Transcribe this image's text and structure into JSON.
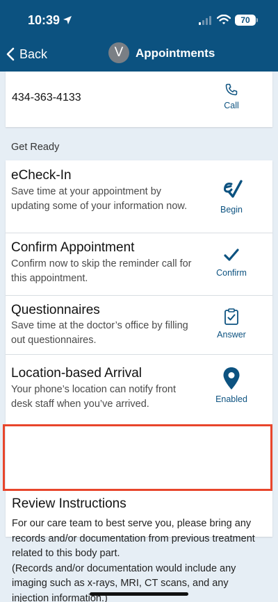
{
  "status_bar": {
    "time": "10:39",
    "battery": "70"
  },
  "nav": {
    "back_label": "Back",
    "avatar_initial": "V",
    "title": "Appointments"
  },
  "phone": {
    "number": "434-363-4133",
    "action_label": "Call"
  },
  "section_label": "Get Ready",
  "items": [
    {
      "title": "eCheck-In",
      "description": "Save time at your appointment by updating some of your information now.",
      "action_label": "Begin",
      "icon": "echeckin-icon"
    },
    {
      "title": "Confirm Appointment",
      "description": "Confirm now to skip the reminder call for this appointment.",
      "action_label": "Confirm",
      "icon": "checkmark-icon"
    },
    {
      "title": "Questionnaires",
      "description": "Save time at the doctor’s office by filling out questionnaires.",
      "action_label": "Answer",
      "icon": "clipboard-check-icon"
    },
    {
      "title": "Location-based Arrival",
      "description": "Your phone’s location can notify front desk staff when you’ve arrived.",
      "action_label": "Enabled",
      "icon": "location-pin-icon"
    }
  ],
  "review": {
    "title": "Review Instructions",
    "body": "For our care team to best serve you, please bring any records and/or documentation from previous treatment related to this body part.\n(Records and/or documentation would include any imaging such as x-rays, MRI, CT scans, and any injection information.)"
  },
  "colors": {
    "header": "#0c5280",
    "accent": "#0c5280",
    "highlight": "#e8452b",
    "background": "#e6eef5"
  }
}
